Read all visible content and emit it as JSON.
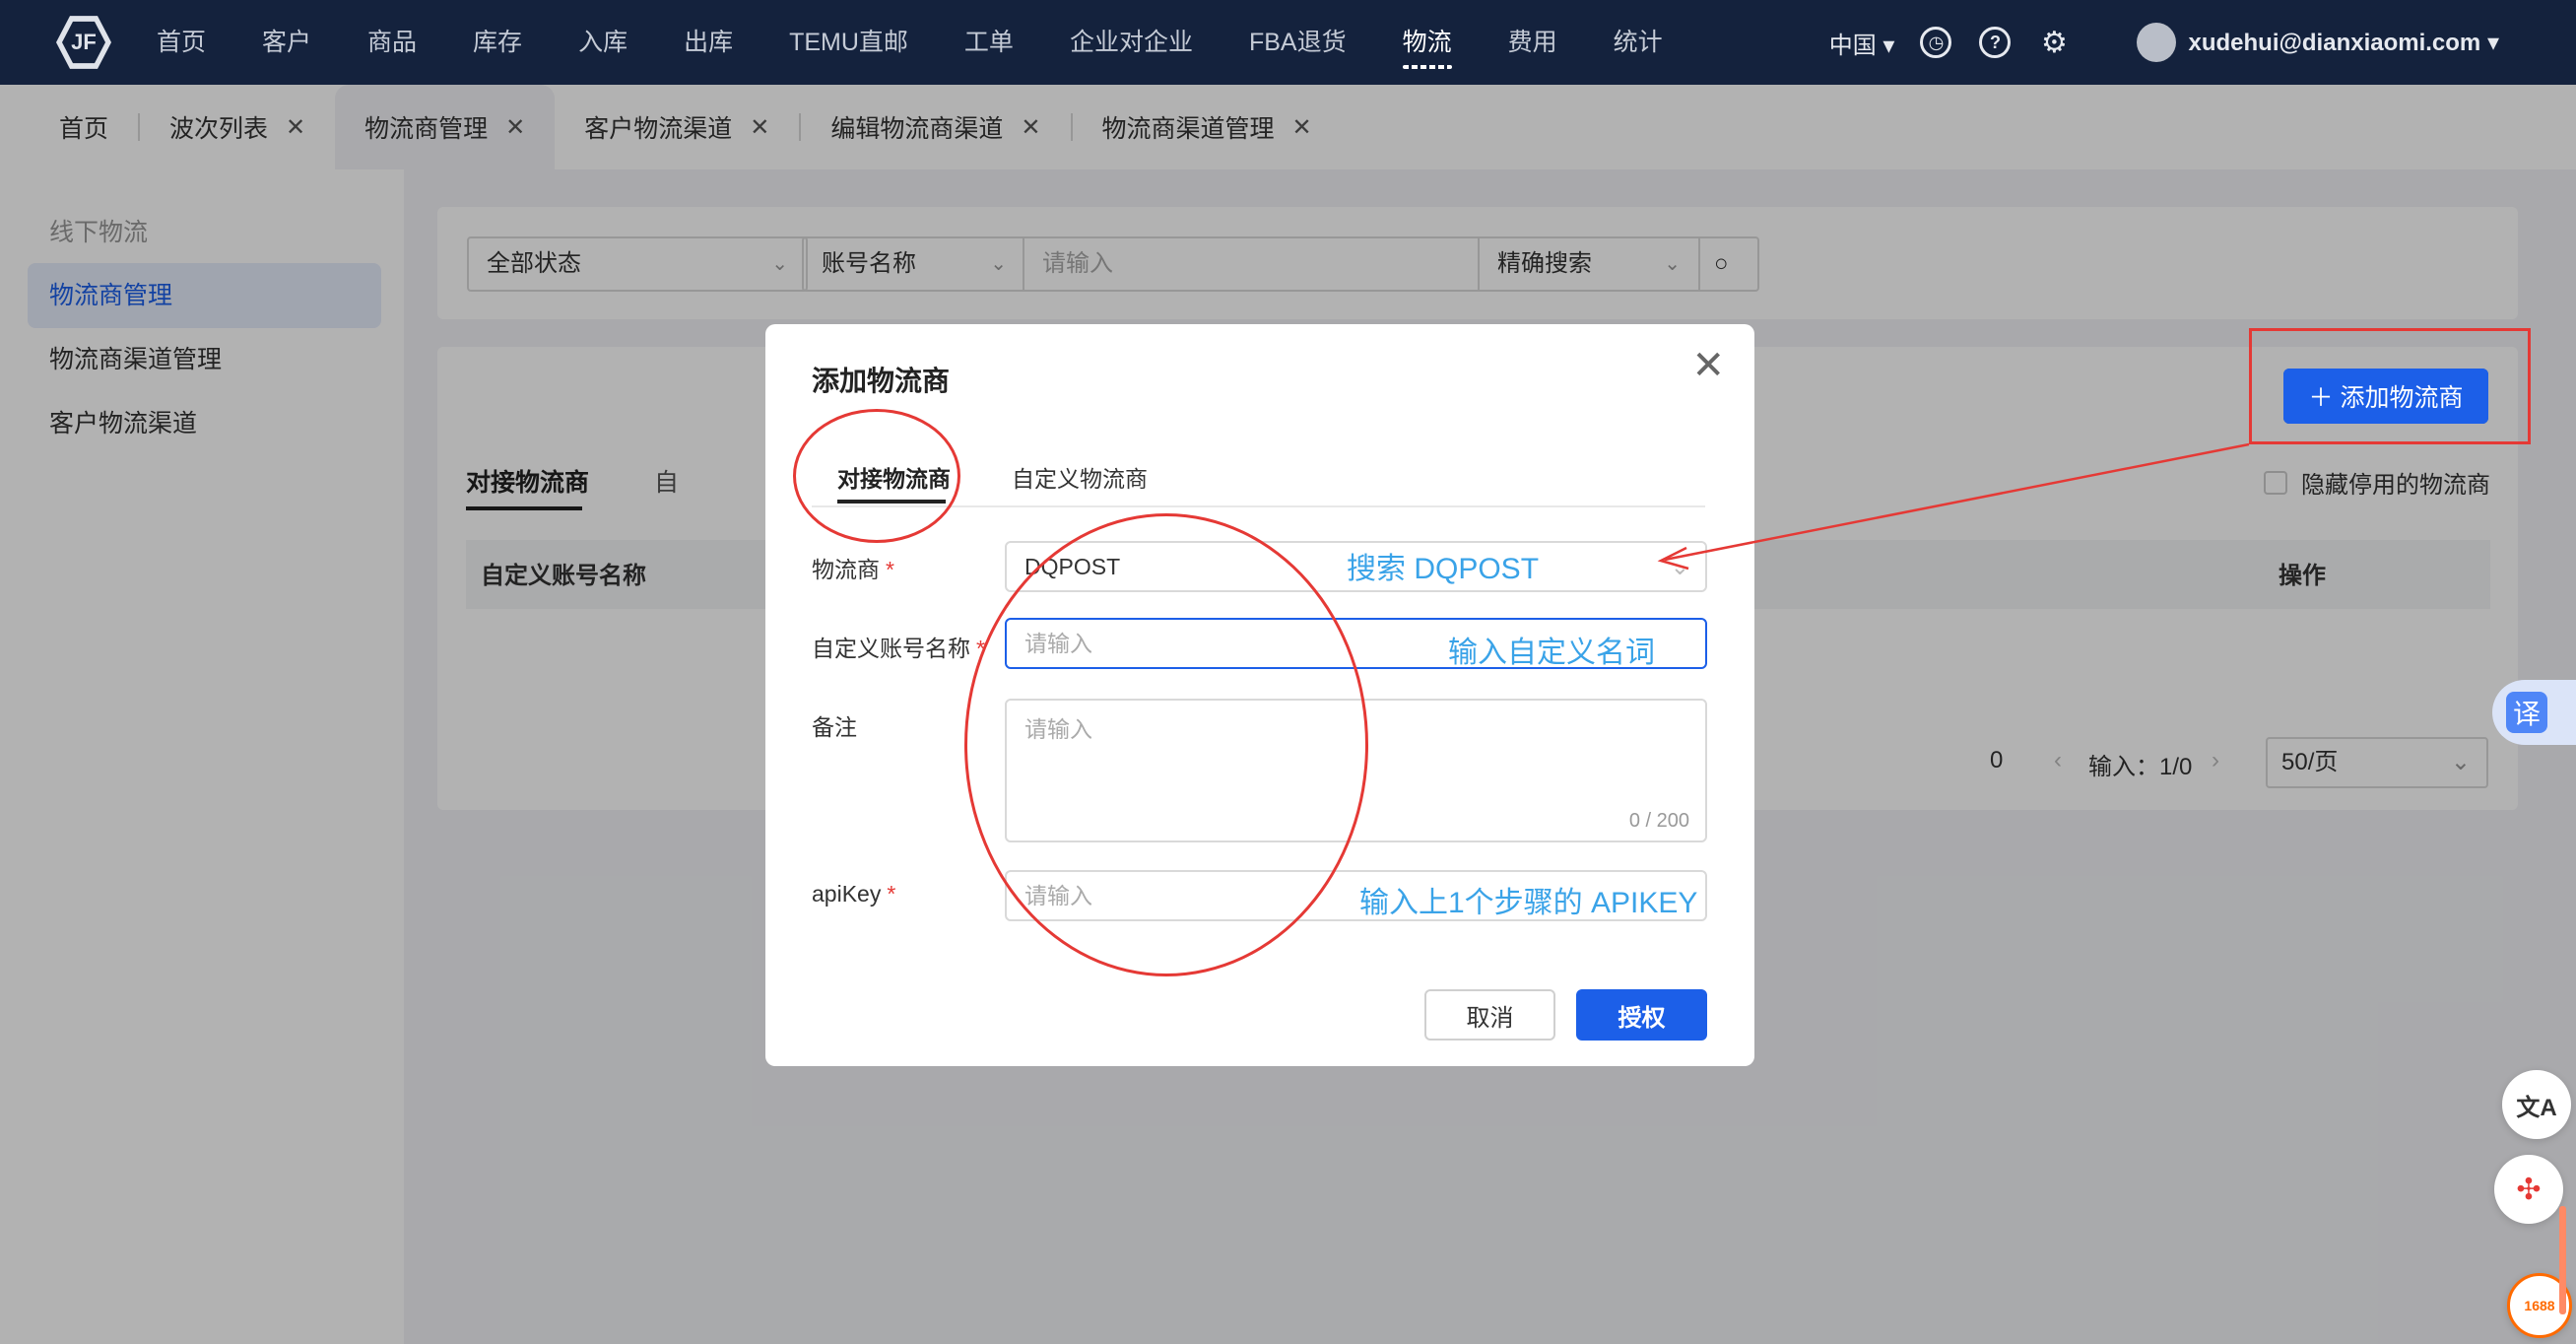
{
  "nav": {
    "logo": "JF",
    "items": [
      "首页",
      "客户",
      "商品",
      "库存",
      "入库",
      "出库",
      "TEMU直邮",
      "工单",
      "企业对企业",
      "FBA退货",
      "物流",
      "费用",
      "统计"
    ],
    "active_index": 10,
    "region": "中国 ▾",
    "clock_icon": "◷",
    "help_icon": "?",
    "settings_icon": "⚙",
    "user": "xudehui@dianxiaomi.com ▾"
  },
  "tabs": [
    {
      "label": "首页",
      "closable": false
    },
    {
      "label": "波次列表",
      "closable": true
    },
    {
      "label": "物流商管理",
      "closable": true,
      "active": true
    },
    {
      "label": "客户物流渠道",
      "closable": true
    },
    {
      "label": "编辑物流商渠道",
      "closable": true
    },
    {
      "label": "物流商渠道管理",
      "closable": true
    }
  ],
  "tab_close": "✕",
  "sidebar": {
    "group": "线下物流",
    "items": [
      "物流商管理",
      "物流商渠道管理",
      "客户物流渠道"
    ]
  },
  "filters": {
    "status": "全部状态",
    "account_field": "账号名称",
    "search_placeholder": "请输入",
    "match_mode": "精确搜索",
    "search_icon": "○"
  },
  "main": {
    "add_button": "＋ 添加物流商",
    "hide_disabled": "隐藏停用的物流商",
    "tabs": [
      "对接物流商",
      "自"
    ],
    "columns": [
      "自定义账号名称",
      "操作"
    ],
    "pager_total": "0",
    "pager_input": "输入：1/0",
    "page_size": "50/页"
  },
  "modal": {
    "title": "添加物流商",
    "close": "✕",
    "tabs": [
      "对接物流商",
      "自定义物流商"
    ],
    "fields": {
      "carrier_label": "物流商",
      "carrier_value": "DQPOST",
      "account_label": "自定义账号名称",
      "account_placeholder": "请输入",
      "remark_label": "备注",
      "remark_placeholder": "请输入",
      "remark_counter": "0 / 200",
      "apikey_label": "apiKey",
      "apikey_placeholder": "请输入"
    },
    "required_mark": "*",
    "cancel": "取消",
    "authorize": "授权"
  },
  "annotations": {
    "search": "搜索 DQPOST",
    "custom_name": "输入自定义名词",
    "apikey": "输入上1个步骤的 APIKEY"
  },
  "floaters": {
    "translate": "译",
    "translate2": "文A",
    "app1688": "1688"
  },
  "colors": {
    "nav_bg": "#14223d",
    "primary": "#1c5fe8",
    "annotation_red": "#e53935",
    "annotation_blue": "#3aa3e8"
  }
}
